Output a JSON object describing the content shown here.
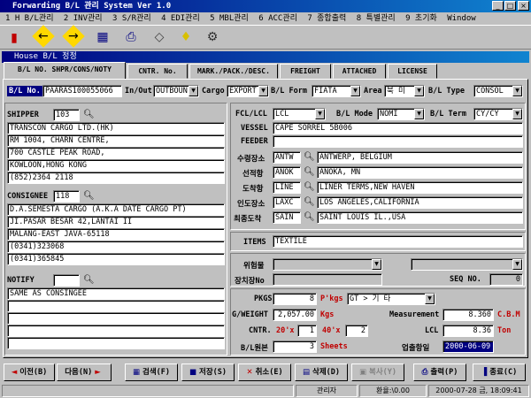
{
  "window": {
    "title": "Forwarding B/L 관리 System Ver 1.0"
  },
  "menu": [
    "1 H B/L관리",
    "2 INV관리",
    "3 S/R관리",
    "4 EDI관리",
    "5 MBL관리",
    "6 ACC관리",
    "7 종합출력",
    "8 특별관리",
    "9 초기화",
    "Window"
  ],
  "subwindow": {
    "title": "House B/L 정정"
  },
  "tabs": [
    "B/L NO. SHPR/CONS/NOTY",
    "CNTR. No.",
    "MARK./PACK./DESC.",
    "FREIGHT",
    "ATTACHED",
    "LICENSE"
  ],
  "header": {
    "bl_no_label": "B/L No.",
    "bl_no": "PAARAS100055066",
    "inout_label": "In/Out",
    "inout": "OUTBOUN",
    "cargo_label": "Cargo",
    "cargo": "EXPORT",
    "bl_form_label": "B/L Form",
    "bl_form": "FIATA",
    "area_label": "Area",
    "area": "북   미",
    "bl_type_label": "B/L Type",
    "bl_type": "CONSOL"
  },
  "shipper": {
    "label": "SHIPPER",
    "code": "103",
    "lines": [
      "TRANSCON CARGO LTD.(HK)",
      "RM 1004, CHARN CENTRE,",
      "700 CASTLE PEAK ROAD,",
      "KOWLOON,HONG KONG",
      "(852)2364 2118"
    ]
  },
  "consignee": {
    "label": "CONSIGNEE",
    "code": "118",
    "lines": [
      "D.A.SEMESTA CARGO (A.K.A DATE CARGO PT)",
      "JI.PASAR BESAR 42,LANTAI II",
      "MALANG-EAST JAVA-65118",
      "(0341)323068",
      "(0341)365845"
    ]
  },
  "notify": {
    "label": "NOTIFY",
    "code": "",
    "lines": [
      "SAME AS CONSINGEE",
      "",
      "",
      "",
      ""
    ]
  },
  "right": {
    "fcl_label": "FCL/LCL",
    "fcl": "LCL",
    "bl_mode_label": "B/L Mode",
    "bl_mode": "NOMI",
    "bl_term_label": "B/L Term",
    "bl_term": "CY/CY",
    "vessel_label": "VESSEL",
    "vessel": "CAPE SORREL 5B006",
    "feeder_label": "FEEDER",
    "feeder": "",
    "ports": [
      {
        "label": "수령장소",
        "code": "ANTW",
        "name": "ANTWERP, BELGIUM"
      },
      {
        "label": "선적항",
        "code": "ANOK",
        "name": "ANOKA, MN"
      },
      {
        "label": "도착항",
        "code": "LINE",
        "name": "LINER TERMS,NEW HAVEN"
      },
      {
        "label": "인도장소",
        "code": "LAXC",
        "name": "LOS ANGELES,CALIFORNIA"
      },
      {
        "label": "최종도착",
        "code": "SAIN",
        "name": "SAINT LOUIS IL.,USA"
      }
    ],
    "items_label": "ITEMS",
    "items": "TEXTILE",
    "danger_label": "위험물",
    "danger": "",
    "danger2": "",
    "loc_label": "장치장No",
    "loc": "",
    "seq_label": "SEQ NO.",
    "seq": "0",
    "pkgs_label": "PKGS",
    "pkgs": "8",
    "pkgs_unit_label": "P'kgs",
    "pkgs_unit": "GT > 기   타",
    "weight_label": "G/WEIGHT",
    "weight": "2,057.00",
    "weight_unit": "Kgs",
    "measurement_label": "Measurement",
    "measurement": "8.360",
    "measurement_unit": "C.B.M",
    "cntr_label": "CNTR.",
    "cntr20_label": "20'x",
    "cntr20": "1",
    "cntr40_label": "40'x",
    "cntr40": "2",
    "lcl_label": "LCL",
    "lcl": "8.36",
    "lcl_unit": "Ton",
    "original_label": "B/L원본",
    "original": "3",
    "original_unit": "Sheets",
    "issue_label": "업출항일",
    "issue_date": "2000-06-09"
  },
  "buttons": {
    "prev": "이전(B)",
    "next": "다음(N)",
    "search": "검색(F)",
    "save": "저장(S)",
    "cancel": "취소(E)",
    "delete": "삭제(D)",
    "copy": "복사(Y)",
    "print": "출력(P)",
    "exit": "종료(C)"
  },
  "status": {
    "user": "관리자",
    "rate": "환율:\\0.00",
    "datetime": "2000-07-28 금, 18:09:41"
  }
}
